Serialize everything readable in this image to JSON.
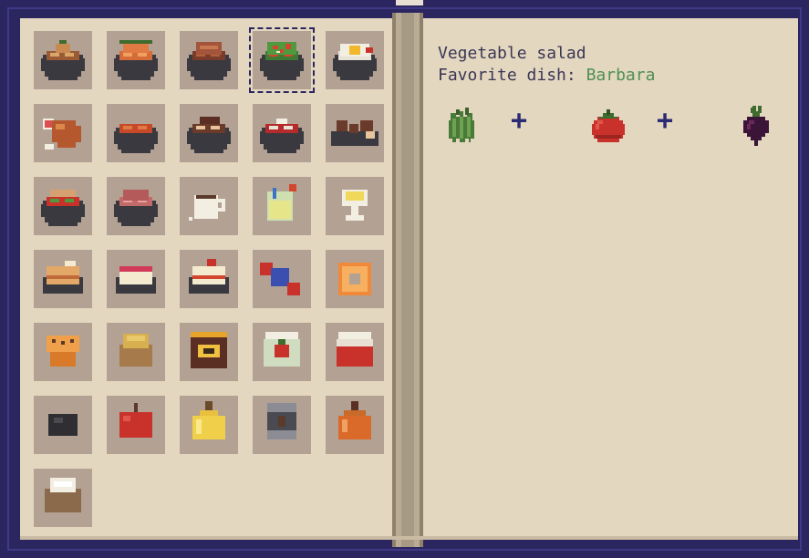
{
  "recipe": {
    "title": "Vegetable salad",
    "favorite_label": "Favorite dish:",
    "favorite_name": "Barbara",
    "ingredients": [
      {
        "icon": "green-pepper-icon"
      },
      {
        "icon": "tomato-icon"
      },
      {
        "icon": "beet-icon"
      }
    ],
    "plus_sign": "+"
  },
  "recipe_book": {
    "selected_index": 3,
    "items": [
      {
        "icon": "stew-bowl-icon"
      },
      {
        "icon": "seafood-bowl-icon"
      },
      {
        "icon": "roast-bowl-icon"
      },
      {
        "icon": "vegetable-salad-icon"
      },
      {
        "icon": "fried-egg-bowl-icon"
      },
      {
        "icon": "chicken-leg-icon"
      },
      {
        "icon": "tomato-soup-icon"
      },
      {
        "icon": "noodle-meat-bowl-icon"
      },
      {
        "icon": "borscht-icon"
      },
      {
        "icon": "meatballs-plate-icon"
      },
      {
        "icon": "salad-plate-icon"
      },
      {
        "icon": "meat-plate-icon"
      },
      {
        "icon": "coffee-cup-icon"
      },
      {
        "icon": "lemonade-glass-icon"
      },
      {
        "icon": "tea-glass-icon"
      },
      {
        "icon": "pie-slice-icon"
      },
      {
        "icon": "cheesecake-slice-icon"
      },
      {
        "icon": "strawberry-cake-slice-icon"
      },
      {
        "icon": "candy-icon"
      },
      {
        "icon": "donut-icon"
      },
      {
        "icon": "muffin-icon"
      },
      {
        "icon": "grain-sack-icon"
      },
      {
        "icon": "honey-jar-icon"
      },
      {
        "icon": "pickled-tomato-jar-icon"
      },
      {
        "icon": "jam-jar-icon"
      },
      {
        "icon": "coal-lump-icon"
      },
      {
        "icon": "apple-icon"
      },
      {
        "icon": "oil-bottle-icon"
      },
      {
        "icon": "coffee-can-icon"
      },
      {
        "icon": "syrup-bottle-icon"
      },
      {
        "icon": "flour-sack-icon"
      }
    ]
  }
}
